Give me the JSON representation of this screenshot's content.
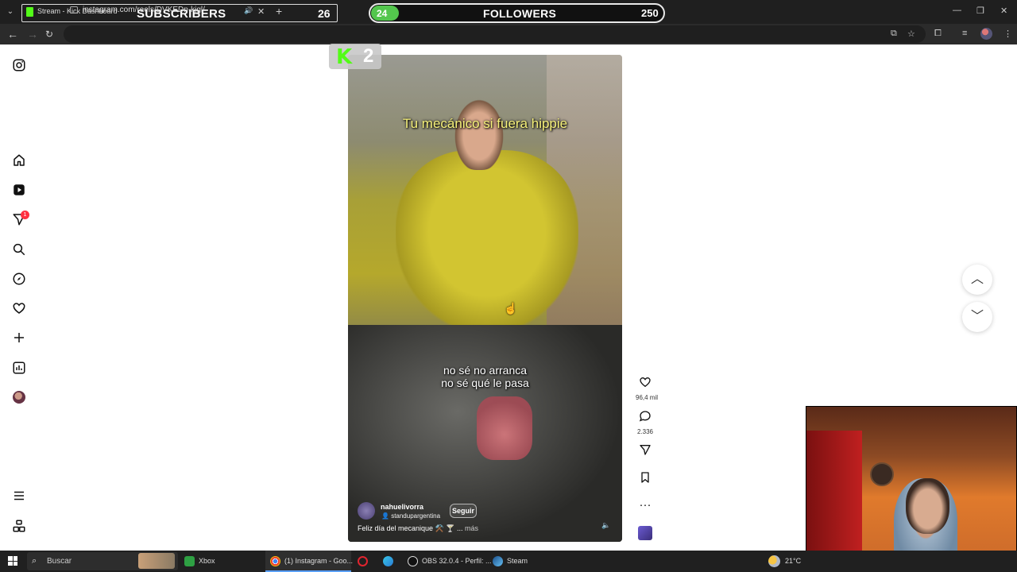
{
  "browser": {
    "tab_title": "Stream - Kick Dashboard",
    "url": "instagram.com/reels/DVKEDn-kjgl/"
  },
  "overlay": {
    "subscribers_label": "SUBSCRIBERS",
    "subscribers_count": "26",
    "followers_current": "24",
    "followers_label": "FOLLOWERS",
    "followers_goal": "250",
    "followers_progress": 0.096,
    "kick_count": "2"
  },
  "sidenav": {
    "items": [
      "instagram-icon",
      "home-icon",
      "reels-icon",
      "messages-icon",
      "search-icon",
      "explore-icon",
      "notifications-icon",
      "create-icon",
      "dashboard-icon",
      "profile-avatar",
      "more-menu-icon",
      "meta-apps-icon"
    ],
    "messages_badge": "1"
  },
  "reel": {
    "title_overlay": "Tu mecánico si fuera hippie",
    "subtitle_line1": "no sé no arranca",
    "subtitle_line2": "no sé qué le pasa",
    "author": "nahuelivorra",
    "collaborator": "standupargentina",
    "follow_label": "Seguir",
    "caption": "Feliz día del mecanique ⚒️ 🍸 ...",
    "caption_more": "más"
  },
  "actions": {
    "likes": "96,4 mil",
    "comments": "2.336"
  },
  "taskbar": {
    "search_placeholder": "Buscar",
    "apps": [
      {
        "label": "Xbox"
      },
      {
        "label": "(1) Instagram - Goo..."
      },
      {
        "label": "OBS 32.0.4 - Perfil: ..."
      },
      {
        "label": "Steam"
      }
    ],
    "temperature": "21°C"
  },
  "colors": {
    "kick_green": "#53fc18",
    "progress_green": "#53c64d",
    "badge_red": "#ff3040"
  }
}
